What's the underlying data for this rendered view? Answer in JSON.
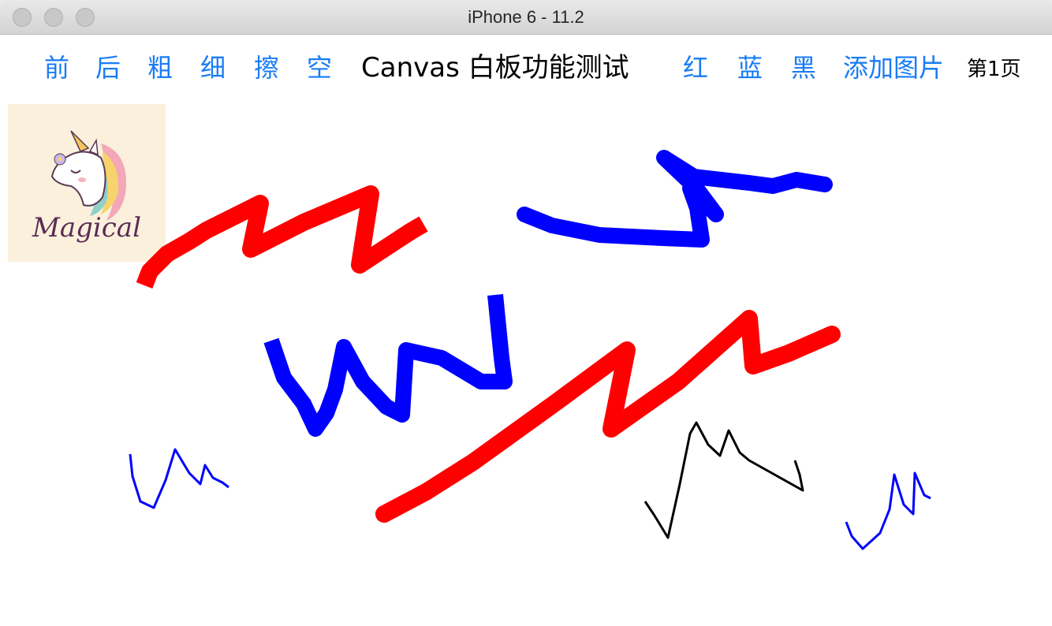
{
  "window": {
    "title": "iPhone 6 - 11.2"
  },
  "toolbar": {
    "left_buttons": [
      "前",
      "后",
      "粗",
      "细",
      "擦",
      "空"
    ],
    "title": "Canvas 白板功能测试",
    "color_buttons": [
      "红",
      "蓝",
      "黑"
    ],
    "add_image": "添加图片",
    "page": "第1页"
  },
  "thumbnail": {
    "caption": "Magical"
  },
  "colors": {
    "accent": "#1a7cf5",
    "red": "#ff0000",
    "blue": "#0000ff",
    "black": "#000000"
  }
}
